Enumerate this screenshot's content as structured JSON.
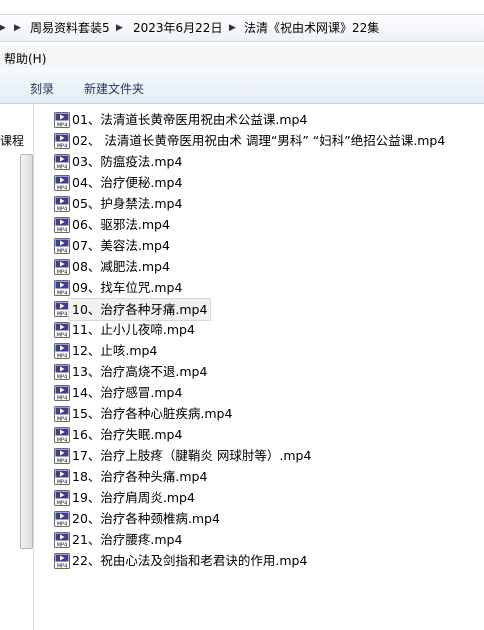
{
  "breadcrumb": {
    "segments": [
      "周易资料套装5",
      "2023年6月22日",
      "法清《祝由术网课》22集"
    ]
  },
  "menu": {
    "help": "帮助(H)"
  },
  "toolbar": {
    "burn": "刻录",
    "new_folder": "新建文件夹"
  },
  "nav": {
    "partial_label": "课程"
  },
  "files": [
    "01、法清道长黄帝医用祝由术公益课.mp4",
    "02、 法清道长黄帝医用祝由术 调理“男科” “妇科”绝招公益课.mp4",
    "03、防瘟疫法.mp4",
    "04、治疗便秘.mp4",
    "05、护身禁法.mp4",
    "06、驱邪法.mp4",
    "07、美容法.mp4",
    "08、减肥法.mp4",
    "09、找车位咒.mp4",
    "10、治疗各种牙痛.mp4",
    "11、止小儿夜啼.mp4",
    "12、止咳.mp4",
    "13、治疗高烧不退.mp4",
    "14、治疗感冒.mp4",
    "15、治疗各种心脏疾病.mp4",
    "16、治疗失眠.mp4",
    "17、治疗上肢疼（腱鞘炎 网球肘等）.mp4",
    "18、治疗各种头痛.mp4",
    "19、治疗肩周炎.mp4",
    "20、治疗各种颈椎病.mp4",
    "21、治疗腰疼.mp4",
    "22、祝由心法及剑指和老君诀的作用.mp4"
  ],
  "file_icon": "mp4-video-icon",
  "icon_label": "MP4",
  "selected_index": 9
}
